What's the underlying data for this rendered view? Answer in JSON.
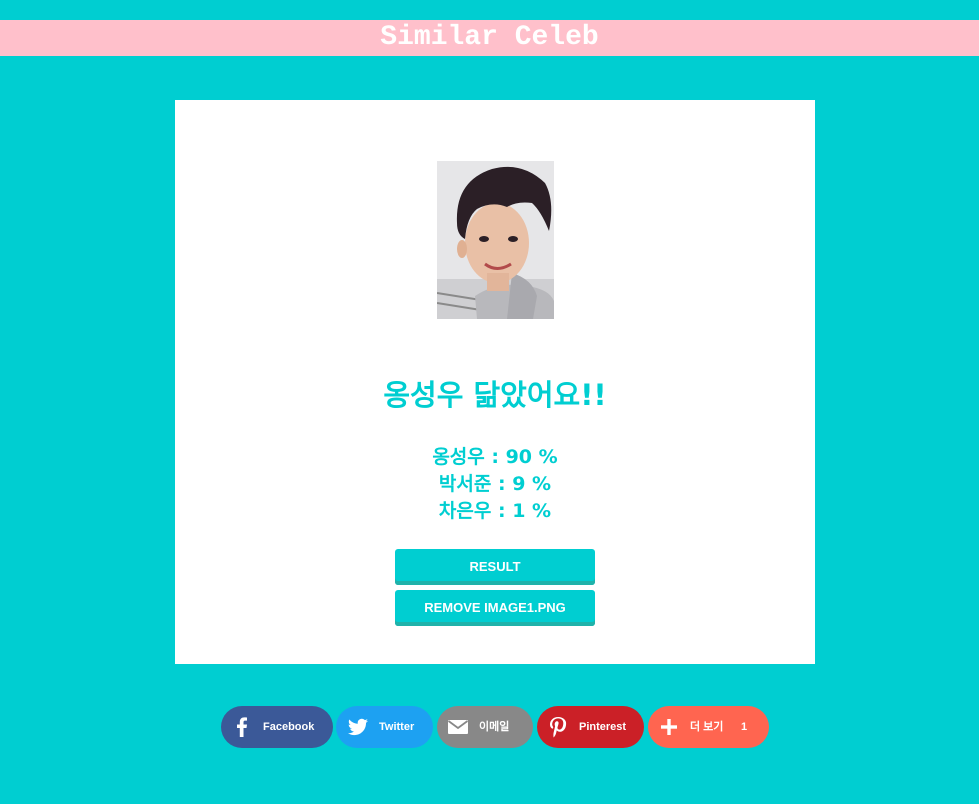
{
  "header": {
    "title": "Similar Celeb"
  },
  "result": {
    "headline": "옹성우 닮았어요!!",
    "scores": [
      "옹성우 : 90 %",
      "박서준 : 9 %",
      "차은우 : 1 %"
    ]
  },
  "buttons": {
    "result_label": "RESULT",
    "remove_label": "REMOVE IMAGE1.PNG"
  },
  "share": {
    "facebook": "Facebook",
    "twitter": "Twitter",
    "email": "이메일",
    "pinterest": "Pinterest",
    "more": "더 보기",
    "more_count": "1"
  },
  "colors": {
    "background": "#00ced1",
    "header": "#ffc0cb",
    "facebook": "#3b5998",
    "twitter": "#1da1f2",
    "email": "#888888",
    "pinterest": "#cb2027",
    "more": "#ff6550"
  },
  "icons": {
    "facebook": "facebook-icon",
    "twitter": "twitter-icon",
    "email": "email-icon",
    "pinterest": "pinterest-icon",
    "more": "plus-icon"
  }
}
